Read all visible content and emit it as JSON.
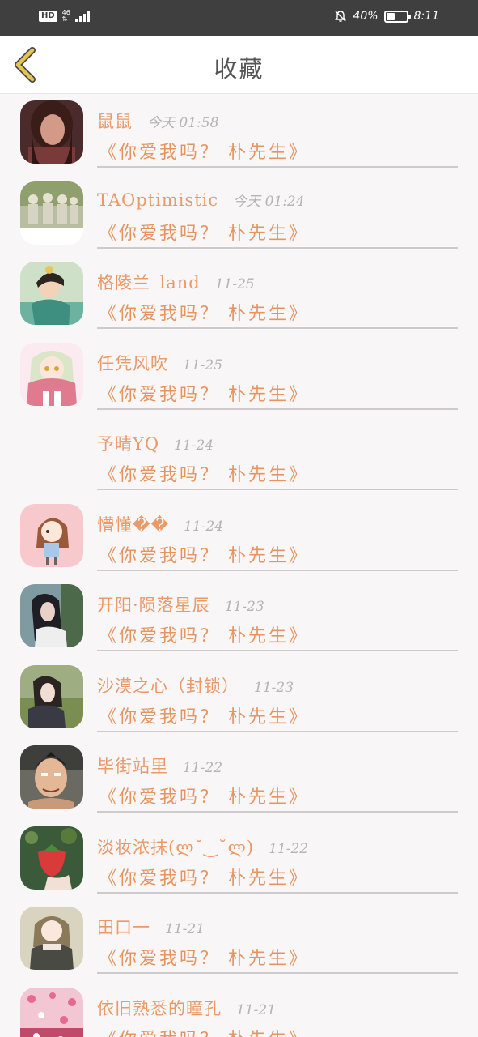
{
  "status_bar": {
    "hd": "HD",
    "network": "46",
    "battery_percent_text": "40%",
    "battery_level": 0.4,
    "time": "8:11"
  },
  "header": {
    "title": "收藏"
  },
  "colors": {
    "accent": "#e79560",
    "username": "#ea9a68",
    "time": "#b6b3b4",
    "status_bar_bg": "#3f3f3f",
    "back_arrow": "#e5c44f"
  },
  "favorites": [
    {
      "username": "鼠鼠",
      "time": "今天 01:58",
      "post_title": "《你爱我吗？ 朴先生》",
      "avatar": "avatar-woman-portrait"
    },
    {
      "username": "TAOptimistic",
      "time": "今天 01:24",
      "post_title": "《你爱我吗？ 朴先生》",
      "avatar": "avatar-group-photo"
    },
    {
      "username": "格陵兰_land",
      "time": "11-25",
      "post_title": "《你爱我吗？ 朴先生》",
      "avatar": "avatar-anime-character"
    },
    {
      "username": "任凭风吹",
      "time": "11-25",
      "post_title": "《你爱我吗？ 朴先生》",
      "avatar": "avatar-anime-girl-pink"
    },
    {
      "username": "予晴YQ",
      "time": "11-24",
      "post_title": "《你爱我吗？ 朴先生》",
      "avatar": "avatar-empty"
    },
    {
      "username": "懵懂��",
      "time": "11-24",
      "post_title": "《你爱我吗？ 朴先生》",
      "avatar": "avatar-cartoon-girl"
    },
    {
      "username": "开阳·陨落星辰",
      "time": "11-23",
      "post_title": "《你爱我吗？ 朴先生》",
      "avatar": "avatar-girl-dark-hair"
    },
    {
      "username": "沙漠之心（封锁）",
      "time": "11-23",
      "post_title": "《你爱我吗？ 朴先生》",
      "avatar": "avatar-girl-in-grass"
    },
    {
      "username": "毕街站里",
      "time": "11-22",
      "post_title": "《你爱我吗？ 朴先生》",
      "avatar": "avatar-anime-man"
    },
    {
      "username": "淡妆浓抹(ლ˘‿˘ლ)",
      "time": "11-22",
      "post_title": "《你爱我吗？ 朴先生》",
      "avatar": "avatar-strawberry"
    },
    {
      "username": "田口一",
      "time": "11-21",
      "post_title": "《你爱我吗？ 朴先生》",
      "avatar": "avatar-anime-girl-green"
    },
    {
      "username": "依旧熟悉的瞳孔",
      "time": "11-21",
      "post_title": "《你爱我吗？ 朴先生》",
      "avatar": "avatar-pink-pattern"
    }
  ]
}
